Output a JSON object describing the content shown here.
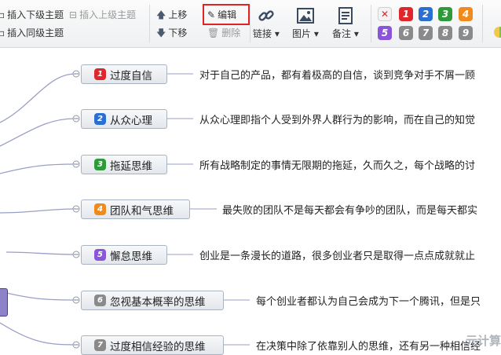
{
  "toolbar": {
    "insert_child": "插入下级主题",
    "insert_parent": "插入上级主题",
    "insert_sibling": "插入同级主题",
    "move_up": "上移",
    "move_down": "下移",
    "edit": "编辑",
    "delete": "删除",
    "link": "链接",
    "image": "图片",
    "note": "备注",
    "priorities_row1": [
      "1",
      "2",
      "3",
      "4"
    ],
    "priorities_row2": [
      "5",
      "6",
      "7",
      "8",
      "9"
    ]
  },
  "topics": [
    {
      "label": "过度自信",
      "priority": "1",
      "note": "对于自己的产品，都有着极高的自信，谈到竞争对手不屑一顾"
    },
    {
      "label": "从众心理",
      "priority": "2",
      "note": "从众心理即指个人受到外界人群行为的影响，而在自己的知觉"
    },
    {
      "label": "拖延思维",
      "priority": "3",
      "note": "所有战略制定的事情无限期的拖延，久而久之，每个战略的讨"
    },
    {
      "label": "团队和气思维",
      "priority": "4",
      "note": "最失败的团队不是每天都会有争吵的团队，而是每天都实"
    },
    {
      "label": "懈怠思维",
      "priority": "5",
      "note": "创业是一条漫长的道路，很多创业者只是取得一点点成就就止"
    },
    {
      "label": "忽视基本概率的思维",
      "priority": "6",
      "note": "每个创业者都认为自己会成为下一个腾讯，但是只"
    },
    {
      "label": "过度相信经验的思维",
      "priority": "7",
      "note": "在决策中除了依靠别人的思维，还有另一种相信经"
    }
  ],
  "colors": {
    "p1": "#e0262b",
    "p2": "#2b6fd0",
    "p3": "#2f9a3a",
    "p4": "#f08a1c",
    "p5": "#8a55d8",
    "p6": "#8a8a8a",
    "p7": "#8a8a8a",
    "p8": "#8a8a8a",
    "p9": "#8a8a8a",
    "highlight": "#e02424",
    "root": "#8e83c8",
    "line": "#9a9fc6"
  },
  "watermark": "元计算"
}
